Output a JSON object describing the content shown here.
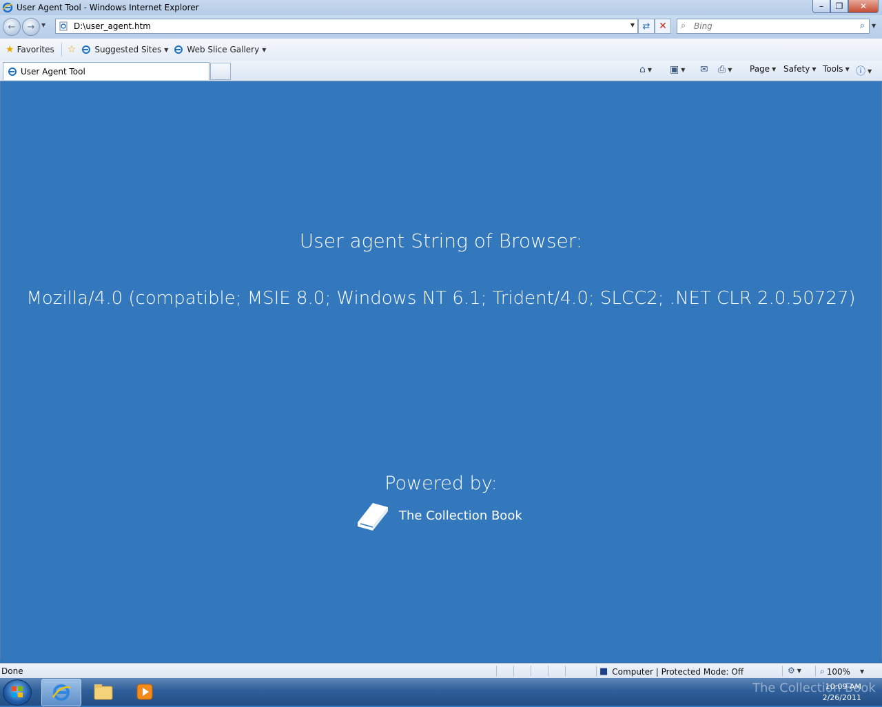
{
  "window": {
    "title": "User Agent Tool - Windows Internet Explorer"
  },
  "address_bar": {
    "url": "D:\\user_agent.htm"
  },
  "search": {
    "placeholder": "Bing"
  },
  "favorites_bar": {
    "favorites_label": "Favorites",
    "suggested_sites_label": "Suggested Sites",
    "web_slice_gallery_label": "Web Slice Gallery"
  },
  "tab": {
    "label": "User Agent Tool"
  },
  "command_bar": {
    "page_label": "Page",
    "safety_label": "Safety",
    "tools_label": "Tools"
  },
  "page": {
    "heading": "User agent String of Browser:",
    "user_agent": "Mozilla/4.0 (compatible; MSIE 8.0; Windows NT 6.1; Trident/4.0; SLCC2; .NET CLR 2.0.50727)",
    "powered_by": "Powered by:",
    "brand_name": "The Collection Book"
  },
  "status_bar": {
    "status": "Done",
    "zone": "Computer | Protected Mode: Off",
    "zoom": "100%"
  },
  "taskbar": {
    "time": "10:09 AM",
    "date": "2/26/2011",
    "watermark": "The Collection Book"
  },
  "colors": {
    "page_background": "#3378bc",
    "text": "#ffffff"
  }
}
